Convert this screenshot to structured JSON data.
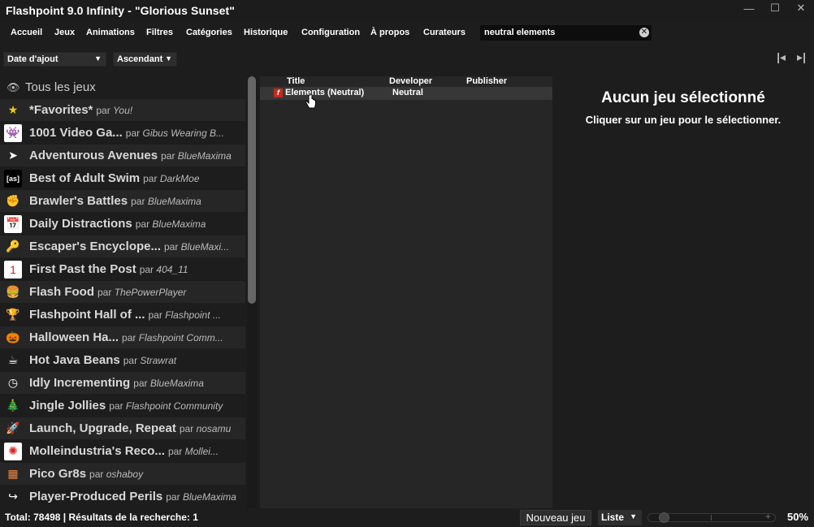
{
  "window": {
    "title": "Flashpoint 9.0 Infinity - \"Glorious Sunset\""
  },
  "menu": [
    "Accueil",
    "Jeux",
    "Animations",
    "Filtres",
    "Catégories",
    "Historique",
    "Configuration",
    "À propos",
    "Curateurs"
  ],
  "search": {
    "value": "neutral elements"
  },
  "sort": {
    "field": "Date d'ajout",
    "order": "Ascendant"
  },
  "sidebar": {
    "all_games": "Tous les jeux",
    "by_prefix": "par",
    "playlists": [
      {
        "name": "*Favorites*",
        "author": "You!",
        "icon": "star-icon"
      },
      {
        "name": "1001 Video Ga...",
        "author": "Gibus Wearing B...",
        "icon": "space-invader-icon"
      },
      {
        "name": "Adventurous Avenues",
        "author": "BlueMaxima",
        "icon": "cursor-arrow-icon"
      },
      {
        "name": "Best of Adult Swim",
        "author": "DarkMoe",
        "icon": "adult-swim-icon"
      },
      {
        "name": "Brawler's Battles",
        "author": "BlueMaxima",
        "icon": "fist-icon"
      },
      {
        "name": "Daily Distractions",
        "author": "BlueMaxima",
        "icon": "calendar-icon"
      },
      {
        "name": "Escaper's Encyclope...",
        "author": "BlueMaxi...",
        "icon": "key-icon"
      },
      {
        "name": "First Past the Post",
        "author": "404_11",
        "icon": "first-place-icon"
      },
      {
        "name": "Flash Food",
        "author": "ThePowerPlayer",
        "icon": "burger-icon"
      },
      {
        "name": "Flashpoint Hall of ...",
        "author": "Flashpoint ...",
        "icon": "trophy-icon"
      },
      {
        "name": "Halloween Ha...",
        "author": "Flashpoint Comm...",
        "icon": "pumpkin-icon"
      },
      {
        "name": "Hot Java Beans",
        "author": "Strawrat",
        "icon": "coffee-icon"
      },
      {
        "name": "Idly Incrementing",
        "author": "BlueMaxima",
        "icon": "clock-icon"
      },
      {
        "name": "Jingle Jollies",
        "author": "Flashpoint Community",
        "icon": "christmas-tree-icon"
      },
      {
        "name": "Launch, Upgrade, Repeat",
        "author": "nosamu",
        "icon": "rocket-icon"
      },
      {
        "name": "Molleindustria's Reco...",
        "author": "Mollei...",
        "icon": "molleindustria-icon"
      },
      {
        "name": "Pico Gr8s",
        "author": "oshaboy",
        "icon": "pico-pixel-icon"
      },
      {
        "name": "Player-Produced Perils",
        "author": "BlueMaxima",
        "icon": "share-arrow-icon"
      }
    ]
  },
  "game_list": {
    "columns": [
      "Title",
      "Developer",
      "Publisher"
    ],
    "rows": [
      {
        "title": "Elements (Neutral)",
        "developer": "Neutral",
        "publisher": "",
        "platform_icon": "flash-icon"
      }
    ]
  },
  "detail": {
    "heading": "Aucun jeu sélectionné",
    "subtext": "Cliquer sur un jeu pour le sélectionner."
  },
  "status": {
    "summary": "Total: 78498 | Résultats de la recherche: 1",
    "new_game": "Nouveau jeu",
    "view_mode": "Liste",
    "zoom": "50%",
    "zoom_level": 0.1
  }
}
